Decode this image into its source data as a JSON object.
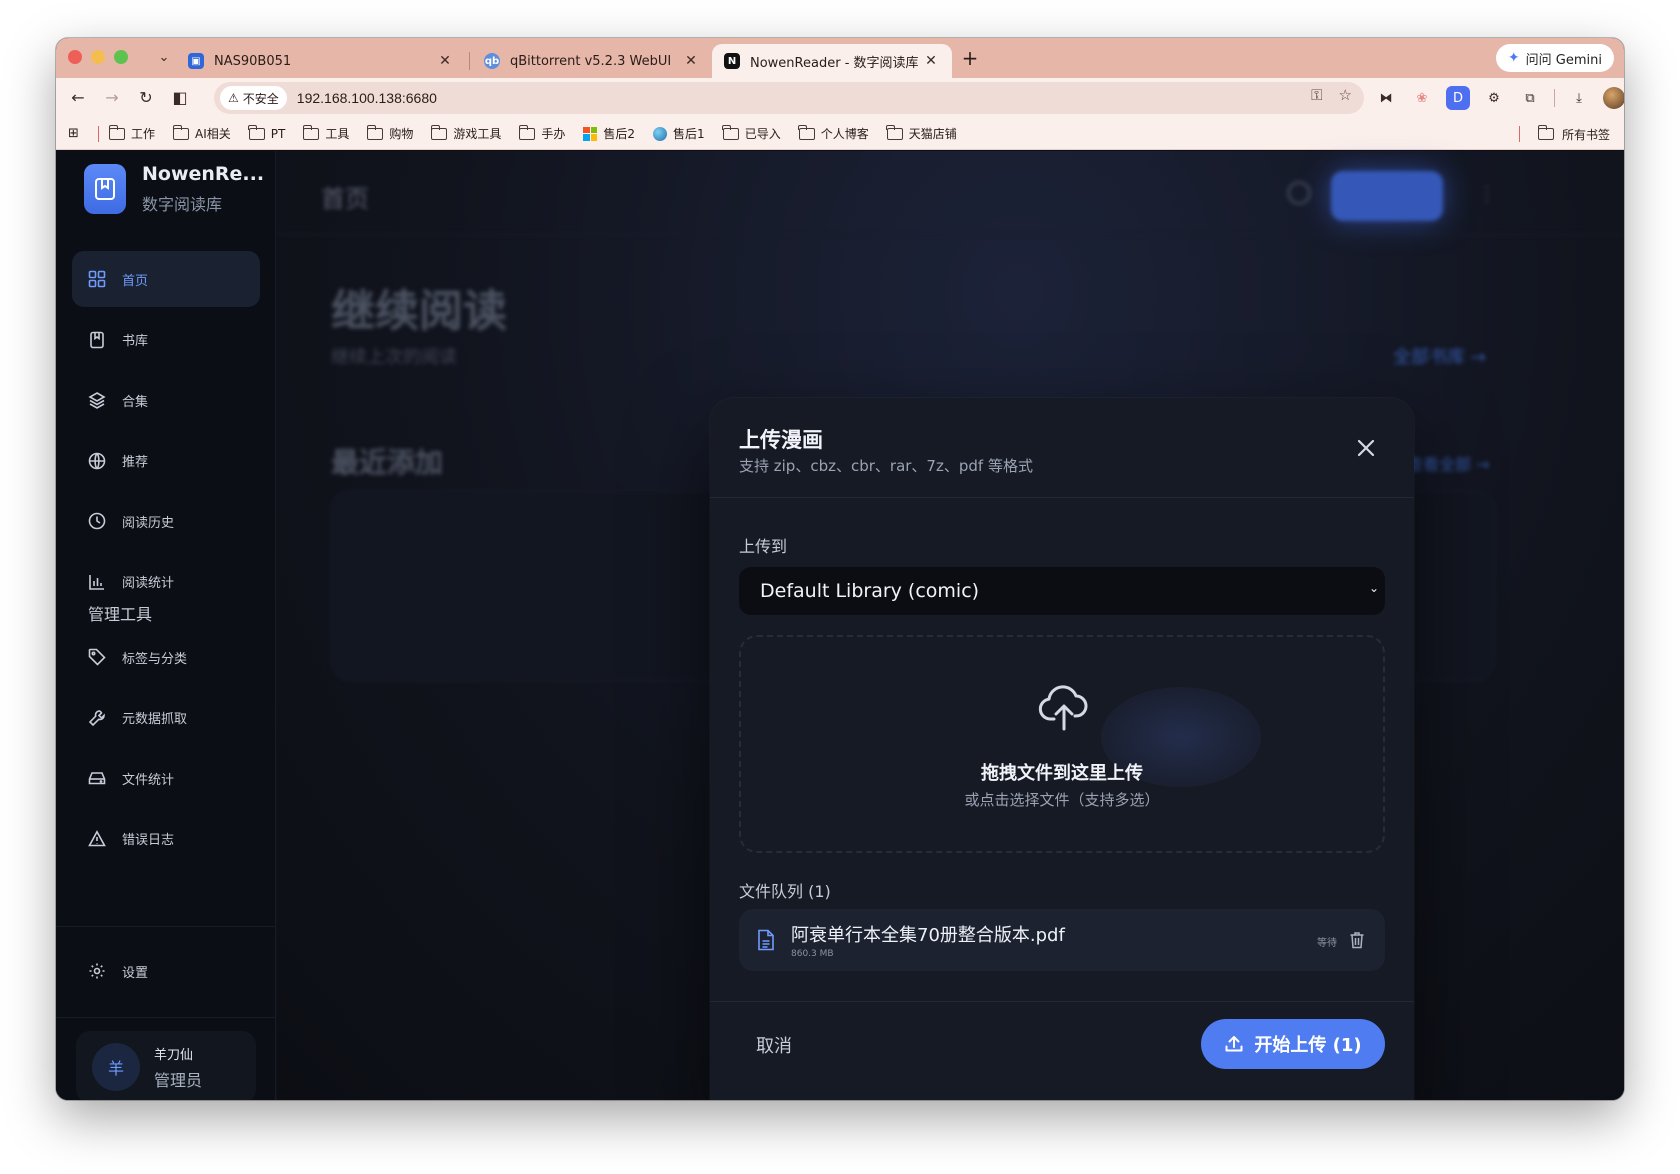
{
  "browser": {
    "tabs": [
      {
        "title": "NAS90B051",
        "favicon": "nas-favicon",
        "active": false
      },
      {
        "title": "qBittorrent v5.2.3 WebUI",
        "favicon": "qbittorrent-favicon",
        "active": false
      },
      {
        "title": "NowenReader - 数字阅读库",
        "favicon": "N",
        "active": true
      }
    ],
    "gemini_label": "问问 Gemini",
    "security_label": "不安全",
    "url": "192.168.100.138:6680",
    "bookmarks": [
      "工作",
      "AI相关",
      "PT",
      "工具",
      "购物",
      "游戏工具",
      "手办",
      "售后2",
      "售后1",
      "已导入",
      "个人博客",
      "天猫店铺"
    ],
    "all_bookmarks": "所有书签"
  },
  "sidebar": {
    "brand_title": "NowenRe...",
    "brand_subtitle": "数字阅读库",
    "nav": [
      {
        "label": "首页",
        "icon": "grid-icon",
        "active": true
      },
      {
        "label": "书库",
        "icon": "book-icon"
      },
      {
        "label": "合集",
        "icon": "layers-icon"
      },
      {
        "label": "推荐",
        "icon": "globe-icon"
      },
      {
        "label": "阅读历史",
        "icon": "clock-icon"
      },
      {
        "label": "阅读统计",
        "icon": "bar-chart-icon"
      }
    ],
    "section_title": "管理工具",
    "tools": [
      {
        "label": "标签与分类",
        "icon": "tag-icon"
      },
      {
        "label": "元数据抓取",
        "icon": "wrench-icon"
      },
      {
        "label": "文件统计",
        "icon": "drive-icon"
      },
      {
        "label": "错误日志",
        "icon": "warning-icon"
      }
    ],
    "settings_label": "设置",
    "user": {
      "initial": "羊",
      "name": "羊刀仙",
      "role": "管理员"
    }
  },
  "main": {
    "page_title": "首页",
    "continue_title": "继续阅读",
    "continue_subtitle": "继续上次的阅读",
    "all_library": "全部书库 →",
    "recent_title": "最近添加",
    "view_all": "查看全部 →"
  },
  "modal": {
    "title": "上传漫画",
    "subtitle": "支持 zip、cbz、cbr、rar、7z、pdf 等格式",
    "upload_to_label": "上传到",
    "library_selected": "Default Library (comic)",
    "dropzone_title": "拖拽文件到这里上传",
    "dropzone_subtitle": "或点击选择文件（支持多选）",
    "queue_label": "文件队列 (1)",
    "queue": [
      {
        "name": "阿衰单行本全集70册整合版本.pdf",
        "size": "860.3 MB",
        "status": "等待"
      }
    ],
    "cancel_label": "取消",
    "start_label": "开始上传 (1)"
  },
  "colors": {
    "accent": "#4f7cf0",
    "sidebar_active_text": "#6f9bff",
    "tabstrip": "#e6b6a9"
  }
}
